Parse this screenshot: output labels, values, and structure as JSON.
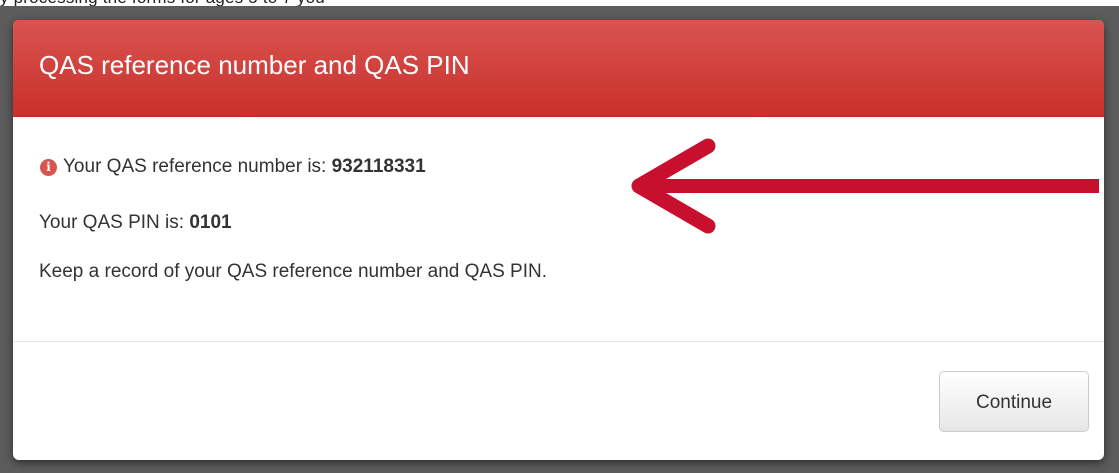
{
  "backdrop": {
    "partial_text": "y                                    processing the forms for ages 5 to 7 you"
  },
  "modal": {
    "title": "QAS reference number and QAS PIN",
    "reference_label": "Your QAS reference number is: ",
    "reference_value": "932118331",
    "pin_label": "Your QAS PIN is: ",
    "pin_value": "0101",
    "note": "Keep a record of your QAS reference number and QAS PIN.",
    "info_icon_glyph": "i",
    "continue_label": "Continue"
  },
  "colors": {
    "header": "#c9302c",
    "arrow": "#c8102e",
    "info_icon": "#d9534f"
  }
}
